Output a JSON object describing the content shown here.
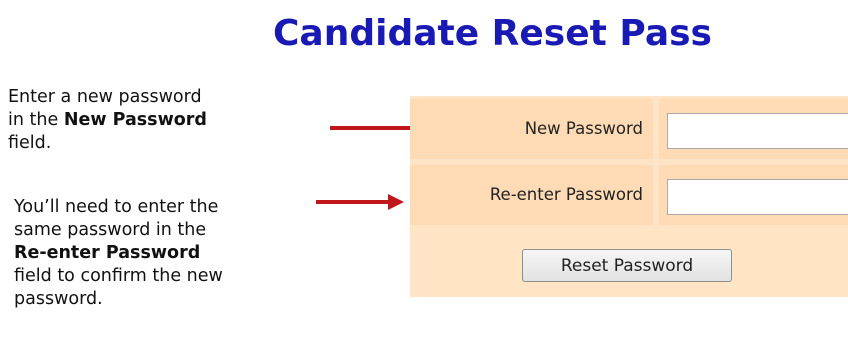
{
  "page": {
    "title": "Candidate Reset Pass"
  },
  "annotations": {
    "new_password_note": {
      "before": "Enter a new password in the ",
      "bold": "New Password",
      "after": " field."
    },
    "reenter_note": {
      "before": "You’ll need to enter the same password in the ",
      "bold": "Re-enter Password",
      "after": " field to confirm the new password."
    }
  },
  "form": {
    "new_password": {
      "label": "New Password",
      "value": ""
    },
    "reenter_password": {
      "label": "Re-enter Password",
      "value": ""
    },
    "submit_label": "Reset Password"
  },
  "colors": {
    "title": "#1919b3",
    "arrow": "#c0171a",
    "form_background": "#ffe4c6",
    "form_cell": "#ffdbb5"
  }
}
